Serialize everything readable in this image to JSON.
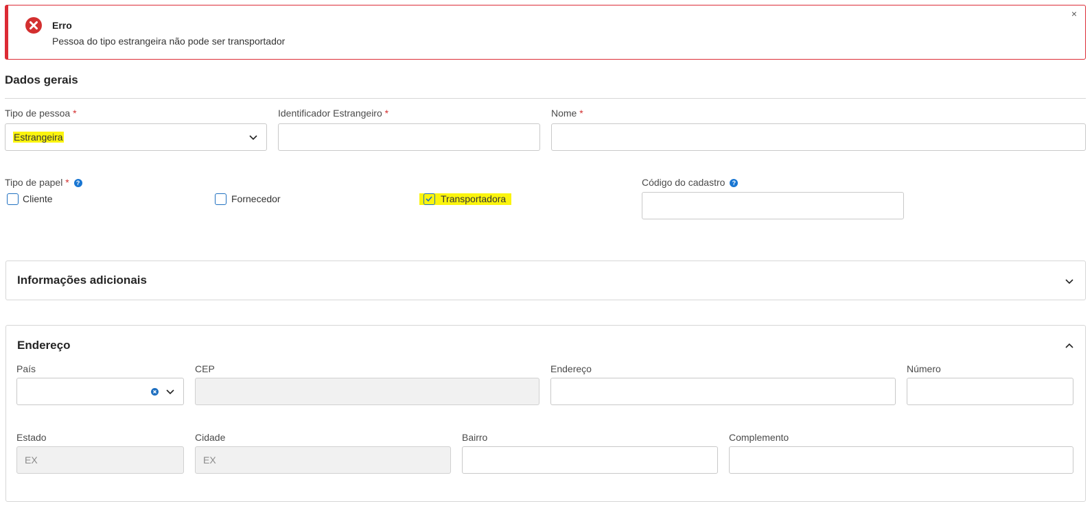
{
  "alert": {
    "title": "Erro",
    "message": "Pessoa do tipo estrangeira não pode ser transportador",
    "close": "×",
    "color": "#dc2b35"
  },
  "dados_gerais": {
    "title": "Dados gerais",
    "tipo_pessoa": {
      "label": "Tipo de pessoa",
      "required": "*",
      "value": "Estrangeira"
    },
    "identificador": {
      "label": "Identificador Estrangeiro",
      "required": "*",
      "value": ""
    },
    "nome": {
      "label": "Nome",
      "required": "*",
      "value": ""
    },
    "tipo_papel": {
      "label": "Tipo de papel",
      "required": "*",
      "options": [
        {
          "label": "Cliente",
          "checked": false
        },
        {
          "label": "Fornecedor",
          "checked": false
        },
        {
          "label": "Transportadora",
          "checked": true
        }
      ]
    },
    "codigo_cadastro": {
      "label": "Código do cadastro",
      "value": ""
    }
  },
  "info_adicionais": {
    "title": "Informações adicionais",
    "expanded": false
  },
  "endereco": {
    "title": "Endereço",
    "expanded": true,
    "pais": {
      "label": "País",
      "value": ""
    },
    "cep": {
      "label": "CEP",
      "value": ""
    },
    "endereco": {
      "label": "Endereço",
      "value": ""
    },
    "numero": {
      "label": "Número",
      "value": ""
    },
    "estado": {
      "label": "Estado",
      "value": "EX"
    },
    "cidade": {
      "label": "Cidade",
      "value": "EX"
    },
    "bairro": {
      "label": "Bairro",
      "value": ""
    },
    "complemento": {
      "label": "Complemento",
      "value": ""
    }
  },
  "icons": {
    "error": "error-circle-icon",
    "help": "question-circle-icon",
    "chevron_down": "chevron-down-icon",
    "chevron_up": "chevron-up-icon",
    "clear": "clear-circle-icon",
    "check": "checkmark-icon"
  },
  "colors": {
    "accent": "#1e6fc0",
    "highlight": "#fbf40e",
    "error": "#d32f2f"
  }
}
